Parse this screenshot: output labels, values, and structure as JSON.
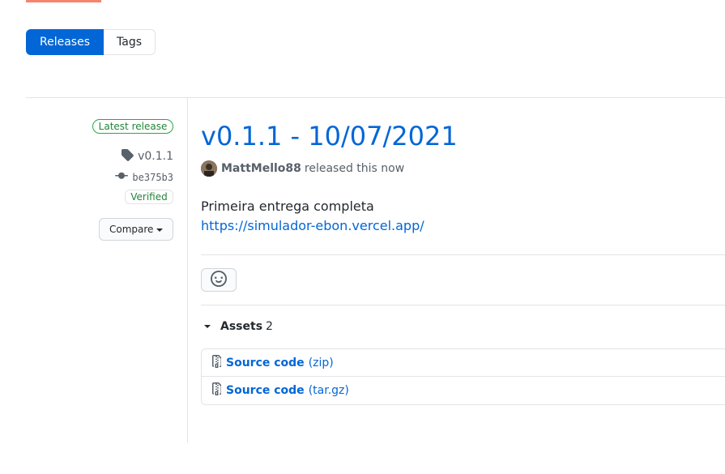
{
  "subnav": {
    "releases_label": "Releases",
    "tags_label": "Tags"
  },
  "sidebar": {
    "latest_badge": "Latest release",
    "tag": "v0.1.1",
    "commit": "be375b3",
    "verified": "Verified",
    "compare_label": "Compare"
  },
  "release": {
    "title": "v0.1.1 - 10/07/2021",
    "author": "MattMello88",
    "released_text": "released this now",
    "body_text": "Primeira entrega completa",
    "body_link": "https://simulador-ebon.vercel.app/"
  },
  "assets": {
    "title": "Assets",
    "count": "2",
    "items": [
      {
        "name": "Source code",
        "ext": "(zip)"
      },
      {
        "name": "Source code",
        "ext": "(tar.gz)"
      }
    ]
  },
  "colors": {
    "link": "#0366d6",
    "accent": "#f9826c",
    "success": "#28a745"
  },
  "icons": [
    "tag-icon",
    "git-commit-icon",
    "smiley-icon",
    "file-zip-icon",
    "triangle-down-icon"
  ]
}
